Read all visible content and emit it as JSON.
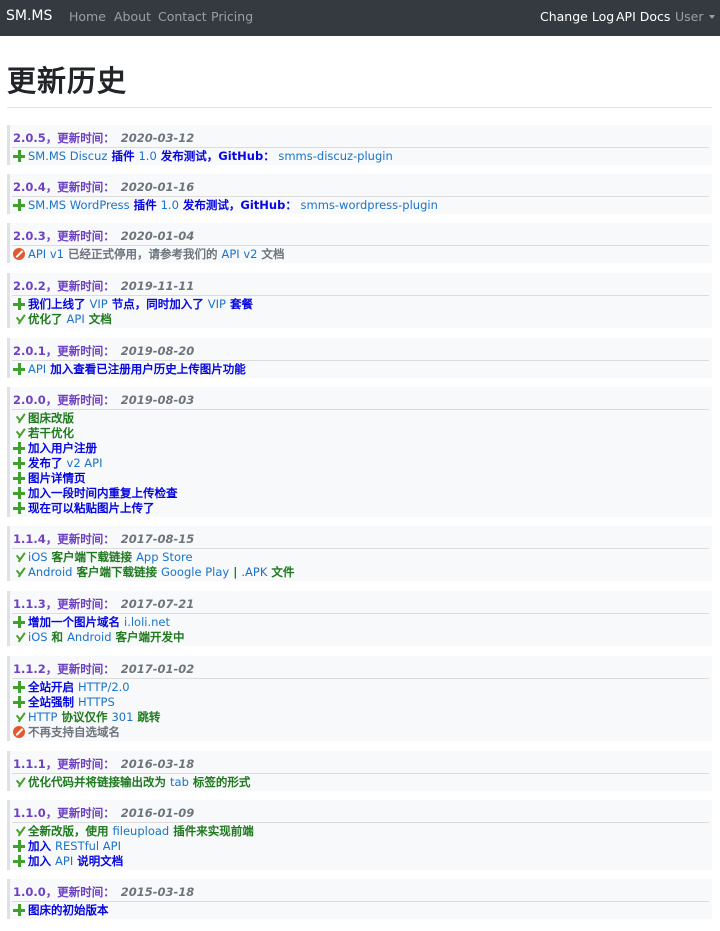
{
  "navbar": {
    "brand": "SM.MS",
    "links": [
      {
        "label": "Home"
      },
      {
        "label": "About"
      },
      {
        "label": "Contact"
      },
      {
        "label": "Pricing"
      }
    ],
    "right_links": [
      {
        "label": "Change Log"
      },
      {
        "label": "API Docs"
      },
      {
        "label": "User"
      }
    ]
  },
  "page": {
    "title": "更新历史"
  },
  "colors": {
    "navbar_bg": "#343a40",
    "version_purple": "#6f42c1",
    "added_blue": "#0606e0",
    "improved_green": "#1f7a1f",
    "link_blue": "#1a73c8",
    "plus_icon_green": "#3fa12c",
    "stop_icon_orange": "#e2572b"
  },
  "icons": {
    "plus": "plus-icon",
    "check": "check-icon",
    "stop": "stop-icon"
  },
  "releases": [
    {
      "version": "2.0.5",
      "time_label": "，更新时间：",
      "date": "2020-03-12",
      "items": [
        {
          "icon": "plus",
          "parts": [
            [
              "SM.MS Discuz",
              "p"
            ],
            [
              " 插件 ",
              "t"
            ],
            [
              "1.0",
              "p"
            ],
            [
              " 发布测试，GitHub：",
              "t"
            ],
            [
              "  smms-discuz-plugin",
              "p"
            ]
          ]
        }
      ]
    },
    {
      "version": "2.0.4",
      "time_label": "，更新时间：",
      "date": "2020-01-16",
      "items": [
        {
          "icon": "plus",
          "parts": [
            [
              "SM.MS WordPress",
              "p"
            ],
            [
              " 插件 ",
              "t"
            ],
            [
              "1.0",
              "p"
            ],
            [
              " 发布测试，GitHub：",
              "t"
            ],
            [
              "  smms-wordpress-plugin",
              "p"
            ]
          ]
        }
      ]
    },
    {
      "version": "2.0.3",
      "time_label": "，更新时间：",
      "date": "2020-01-04",
      "items": [
        {
          "icon": "stop",
          "parts": [
            [
              "API v1",
              "p"
            ],
            [
              " 已经正式停用，请参考我们的 ",
              "t"
            ],
            [
              "API v2",
              "p"
            ],
            [
              " 文档",
              "t"
            ]
          ]
        }
      ]
    },
    {
      "version": "2.0.2",
      "time_label": "，更新时间：",
      "date": "2019-11-11",
      "items": [
        {
          "icon": "plus",
          "parts": [
            [
              "我们上线了 ",
              "t"
            ],
            [
              "VIP",
              "p"
            ],
            [
              " 节点，同时加入了 ",
              "t"
            ],
            [
              "VIP",
              "p"
            ],
            [
              " 套餐",
              "t"
            ]
          ]
        },
        {
          "icon": "check",
          "parts": [
            [
              "优化了 ",
              "t"
            ],
            [
              "API",
              "p"
            ],
            [
              " 文档",
              "t"
            ]
          ]
        }
      ]
    },
    {
      "version": "2.0.1",
      "time_label": "，更新时间：",
      "date": "2019-08-20",
      "items": [
        {
          "icon": "plus",
          "parts": [
            [
              "API",
              "p"
            ],
            [
              " 加入查看已注册用户历史上传图片功能",
              "t"
            ]
          ]
        }
      ]
    },
    {
      "version": "2.0.0",
      "time_label": "，更新时间：",
      "date": "2019-08-03",
      "items": [
        {
          "icon": "check",
          "parts": [
            [
              "图床改版",
              "t"
            ]
          ]
        },
        {
          "icon": "check",
          "parts": [
            [
              "若干优化",
              "t"
            ]
          ]
        },
        {
          "icon": "plus",
          "parts": [
            [
              "加入用户注册",
              "t"
            ]
          ]
        },
        {
          "icon": "plus",
          "parts": [
            [
              "发布了 ",
              "t"
            ],
            [
              "v2 API",
              "p"
            ]
          ]
        },
        {
          "icon": "plus",
          "parts": [
            [
              "图片详情页",
              "t"
            ]
          ]
        },
        {
          "icon": "plus",
          "parts": [
            [
              "加入一段时间内重复上传检查",
              "t"
            ]
          ]
        },
        {
          "icon": "plus",
          "parts": [
            [
              "现在可以粘贴图片上传了",
              "t"
            ]
          ]
        }
      ]
    },
    {
      "version": "1.1.4",
      "time_label": "，更新时间：",
      "date": "2017-08-15",
      "items": [
        {
          "icon": "check",
          "parts": [
            [
              "iOS",
              "p"
            ],
            [
              " 客户端下载链接 ",
              "t"
            ],
            [
              "App Store",
              "p"
            ]
          ]
        },
        {
          "icon": "check",
          "parts": [
            [
              "Android",
              "p"
            ],
            [
              " 客户端下载链接 ",
              "t"
            ],
            [
              "Google Play",
              "p"
            ],
            [
              " | ",
              "t"
            ],
            [
              ".APK",
              "p"
            ],
            [
              " 文件",
              "t"
            ]
          ]
        }
      ]
    },
    {
      "version": "1.1.3",
      "time_label": "，更新时间：",
      "date": "2017-07-21",
      "items": [
        {
          "icon": "plus",
          "parts": [
            [
              "增加一个图片域名 ",
              "t"
            ],
            [
              "i.loli.net",
              "p"
            ]
          ]
        },
        {
          "icon": "check",
          "parts": [
            [
              "iOS",
              "p"
            ],
            [
              " 和 ",
              "t"
            ],
            [
              "Android",
              "p"
            ],
            [
              " 客户端开发中",
              "t"
            ]
          ]
        }
      ]
    },
    {
      "version": "1.1.2",
      "time_label": "，更新时间：",
      "date": "2017-01-02",
      "items": [
        {
          "icon": "plus",
          "parts": [
            [
              "全站开启 ",
              "t"
            ],
            [
              "HTTP/2.0",
              "p"
            ]
          ]
        },
        {
          "icon": "plus",
          "parts": [
            [
              "全站强制 ",
              "t"
            ],
            [
              "HTTPS",
              "p"
            ]
          ]
        },
        {
          "icon": "check",
          "parts": [
            [
              "HTTP",
              "p"
            ],
            [
              " 协议仅作 ",
              "t"
            ],
            [
              "301",
              "p"
            ],
            [
              " 跳转",
              "t"
            ]
          ]
        },
        {
          "icon": "stop",
          "parts": [
            [
              "不再支持自选域名",
              "t"
            ]
          ]
        }
      ]
    },
    {
      "version": "1.1.1",
      "time_label": "，更新时间：",
      "date": "2016-03-18",
      "items": [
        {
          "icon": "check",
          "parts": [
            [
              "优化代码并将链接输出改为 ",
              "t"
            ],
            [
              "tab",
              "p"
            ],
            [
              " 标签的形式",
              "t"
            ]
          ]
        }
      ]
    },
    {
      "version": "1.1.0",
      "time_label": "，更新时间：",
      "date": "2016-01-09",
      "items": [
        {
          "icon": "check",
          "parts": [
            [
              "全新改版，使用 ",
              "t"
            ],
            [
              "fileupload",
              "p"
            ],
            [
              " 插件来实现前端",
              "t"
            ]
          ]
        },
        {
          "icon": "plus",
          "parts": [
            [
              "加入 ",
              "t"
            ],
            [
              "RESTful API",
              "p"
            ]
          ]
        },
        {
          "icon": "plus",
          "parts": [
            [
              "加入 ",
              "t"
            ],
            [
              "API",
              "p"
            ],
            [
              " 说明文档",
              "t"
            ]
          ]
        }
      ]
    },
    {
      "version": "1.0.0",
      "time_label": "，更新时间：",
      "date": "2015-03-18",
      "items": [
        {
          "icon": "plus",
          "parts": [
            [
              "图床的初始版本",
              "t"
            ]
          ]
        }
      ]
    }
  ]
}
